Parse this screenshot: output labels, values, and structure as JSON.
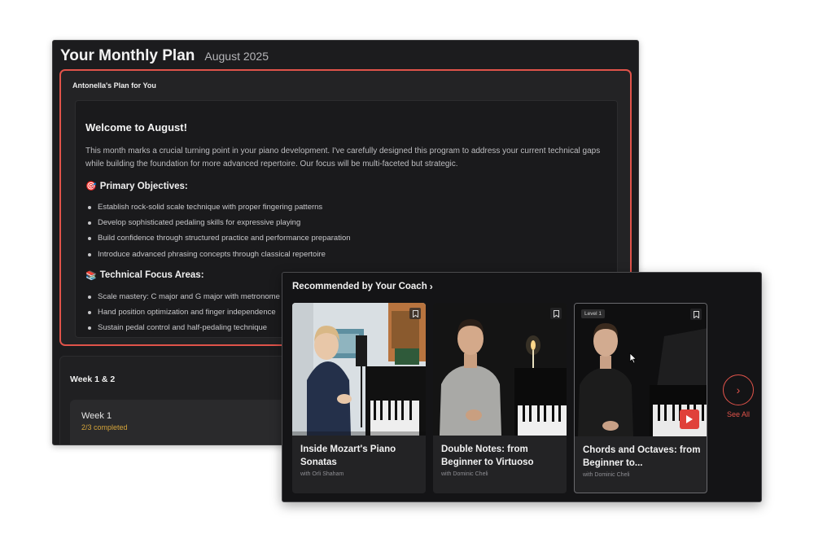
{
  "plan": {
    "title": "Your Monthly Plan",
    "month": "August 2025",
    "coach_panel_label": "Antonella's Plan for You",
    "welcome_heading": "Welcome to August!",
    "intro_paragraph": "This month marks a crucial turning point in your piano development. I've carefully designed this program to address your current technical gaps while building the foundation for more advanced repertoire. Our focus will be multi-faceted but strategic.",
    "objectives_emoji": "🎯",
    "objectives_heading": "Primary Objectives:",
    "objectives": [
      "Establish rock-solid scale technique with proper fingering patterns",
      "Develop sophisticated pedaling skills for expressive playing",
      "Build confidence through structured practice and performance preparation",
      "Introduce advanced phrasing concepts through classical repertoire"
    ],
    "focus_emoji": "📚",
    "focus_heading": "Technical Focus Areas:",
    "focus_items": [
      "Scale mastery: C major and G major with metronome",
      "Hand position optimization and finger independence",
      "Sustain pedal control and half-pedaling technique"
    ]
  },
  "weeks": {
    "section_title": "Week 1 & 2",
    "week1_name": "Week 1",
    "week1_progress": "2/3 completed"
  },
  "recommended": {
    "title": "Recommended by Your Coach",
    "chevron": "›",
    "see_all_icon": "›",
    "see_all_label": "See All",
    "courses": [
      {
        "title": "Inside Mozart's Piano Sonatas",
        "instructor": "with Orli Shaham",
        "badge": ""
      },
      {
        "title": "Double Notes: from Beginner to Virtuoso",
        "instructor": "with Dominic Cheli",
        "badge": ""
      },
      {
        "title": "Chords and Octaves: from Beginner to...",
        "instructor": "with Dominic Cheli",
        "badge": "Level 1"
      }
    ]
  },
  "colors": {
    "accent": "#e0534a",
    "background": "#1c1c1e",
    "progress": "#d5a43a"
  }
}
